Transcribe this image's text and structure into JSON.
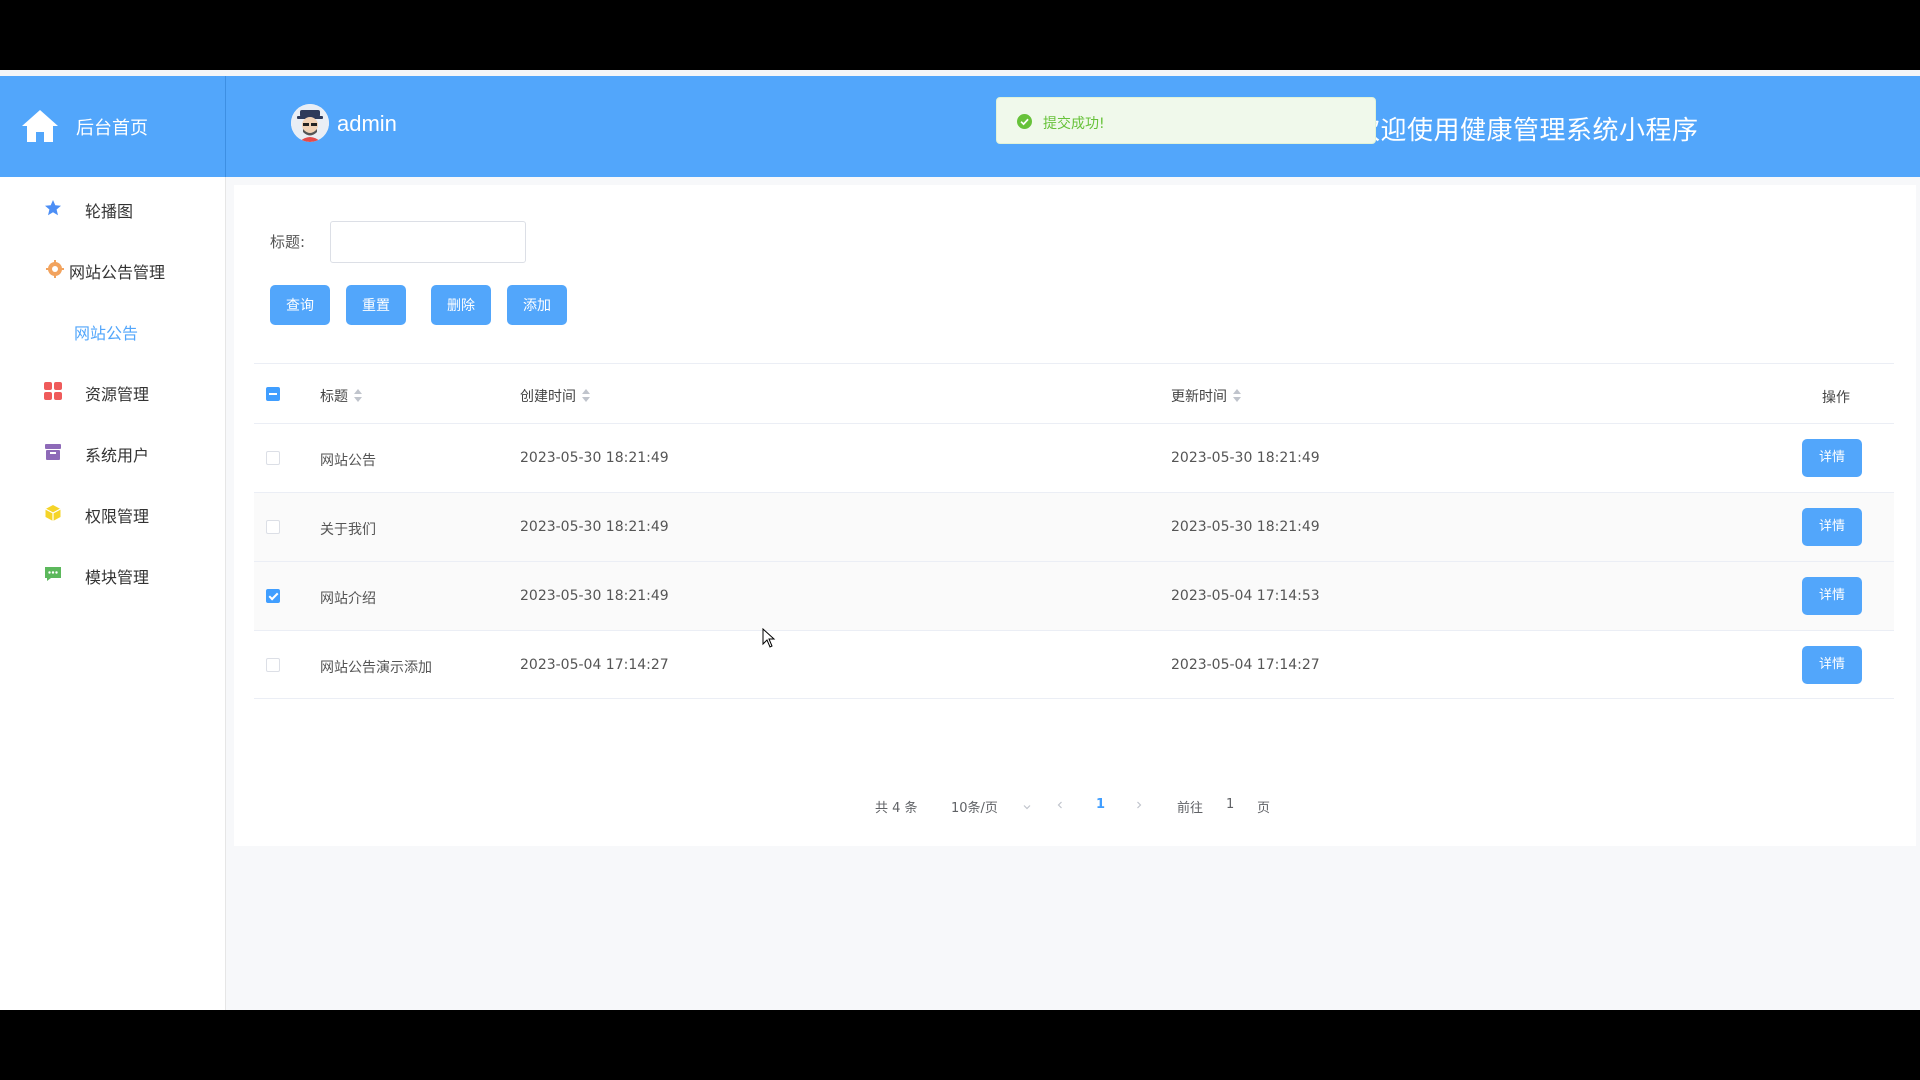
{
  "sidebar": {
    "brand_label": "后台首页",
    "items": [
      {
        "label": "轮播图",
        "icon": "star-icon",
        "color": "#4c8ef5"
      },
      {
        "label": "网站公告管理",
        "icon": "gear-badge-icon",
        "color": "#f2a35e"
      },
      {
        "label": "网站公告",
        "icon": "",
        "active": true
      },
      {
        "label": "资源管理",
        "icon": "grid-icon",
        "color": "#ef5b5b"
      },
      {
        "label": "系统用户",
        "icon": "archive-icon",
        "color": "#8e6ab8"
      },
      {
        "label": "权限管理",
        "icon": "cube-icon",
        "color": "#f5d428"
      },
      {
        "label": "模块管理",
        "icon": "chat-icon",
        "color": "#5cb85c"
      }
    ]
  },
  "header": {
    "username": "admin",
    "welcome": "欢迎使用健康管理系统小程序"
  },
  "toast": {
    "text": "提交成功!"
  },
  "search": {
    "label": "标题:",
    "value": "",
    "buttons": {
      "query": "查询",
      "reset": "重置",
      "delete": "删除",
      "add": "添加"
    }
  },
  "table": {
    "headers": {
      "title": "标题",
      "created": "创建时间",
      "updated": "更新时间",
      "actions": "操作"
    },
    "rows": [
      {
        "title": "网站公告",
        "created": "2023-05-30 18:21:49",
        "updated": "2023-05-30 18:21:49",
        "checked": false,
        "action": "详情"
      },
      {
        "title": "关于我们",
        "created": "2023-05-30 18:21:49",
        "updated": "2023-05-30 18:21:49",
        "checked": false,
        "action": "详情"
      },
      {
        "title": "网站介绍",
        "created": "2023-05-30 18:21:49",
        "updated": "2023-05-04 17:14:53",
        "checked": true,
        "action": "详情"
      },
      {
        "title": "网站公告演示添加",
        "created": "2023-05-04 17:14:27",
        "updated": "2023-05-04 17:14:27",
        "checked": false,
        "action": "详情"
      }
    ]
  },
  "pagination": {
    "total": "共 4 条",
    "page_size": "10条/页",
    "current_page": "1",
    "goto_prefix": "前往",
    "goto_value": "1",
    "goto_suffix": "页"
  },
  "colors": {
    "primary": "#52a6fb",
    "success": "#67c23a"
  }
}
